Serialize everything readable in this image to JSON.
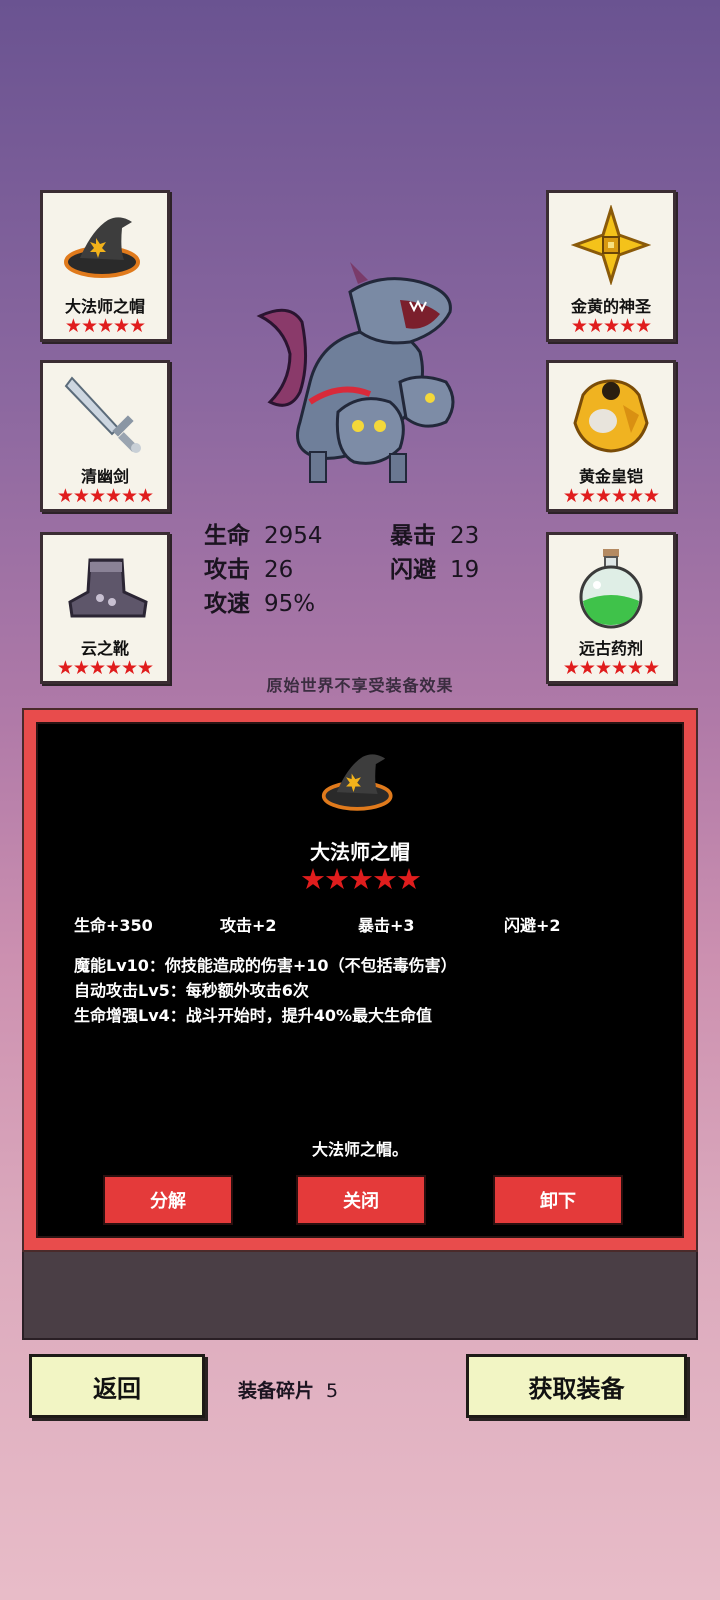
{
  "equipment_slots": [
    {
      "name": "大法师之帽",
      "stars": "★★★★★",
      "icon": "wizard-hat-icon"
    },
    {
      "name": "清幽剑",
      "stars": "★★★★★★",
      "icon": "sword-icon"
    },
    {
      "name": "云之靴",
      "stars": "★★★★★★",
      "icon": "boots-icon"
    },
    {
      "name": "金黄的神圣",
      "stars": "★★★★★",
      "icon": "gold-cross-icon"
    },
    {
      "name": "黄金皇铠",
      "stars": "★★★★★★",
      "icon": "gold-armor-icon"
    },
    {
      "name": "远古药剂",
      "stars": "★★★★★★",
      "icon": "potion-icon"
    }
  ],
  "stats": {
    "hp_label": "生命",
    "hp_value": "2954",
    "atk_label": "攻击",
    "atk_value": "26",
    "spd_label": "攻速",
    "spd_value": "95%",
    "crit_label": "暴击",
    "crit_value": "23",
    "dodge_label": "闪避",
    "dodge_value": "19"
  },
  "notice": "原始世界不享受装备效果",
  "detail": {
    "name": "大法师之帽",
    "stars": "★★★★★",
    "attributes": [
      "生命+350",
      "攻击+2",
      "暴击+3",
      "闪避+2"
    ],
    "skills": [
      "魔能Lv10：你技能造成的伤害+10（不包括毒伤害）",
      "自动攻击Lv5：每秒额外攻击6次",
      "生命增强Lv4：战斗开始时，提升40%最大生命值"
    ],
    "description": "大法师之帽。",
    "buttons": {
      "decompose": "分解",
      "close": "关闭",
      "unequip": "卸下"
    }
  },
  "footer": {
    "back": "返回",
    "shards_label": "装备碎片",
    "shards_value": "5",
    "obtain": "获取装备"
  },
  "colors": {
    "star": "#e01d1d",
    "button_red": "#e43a3a",
    "button_cream": "#f2f5c4"
  }
}
